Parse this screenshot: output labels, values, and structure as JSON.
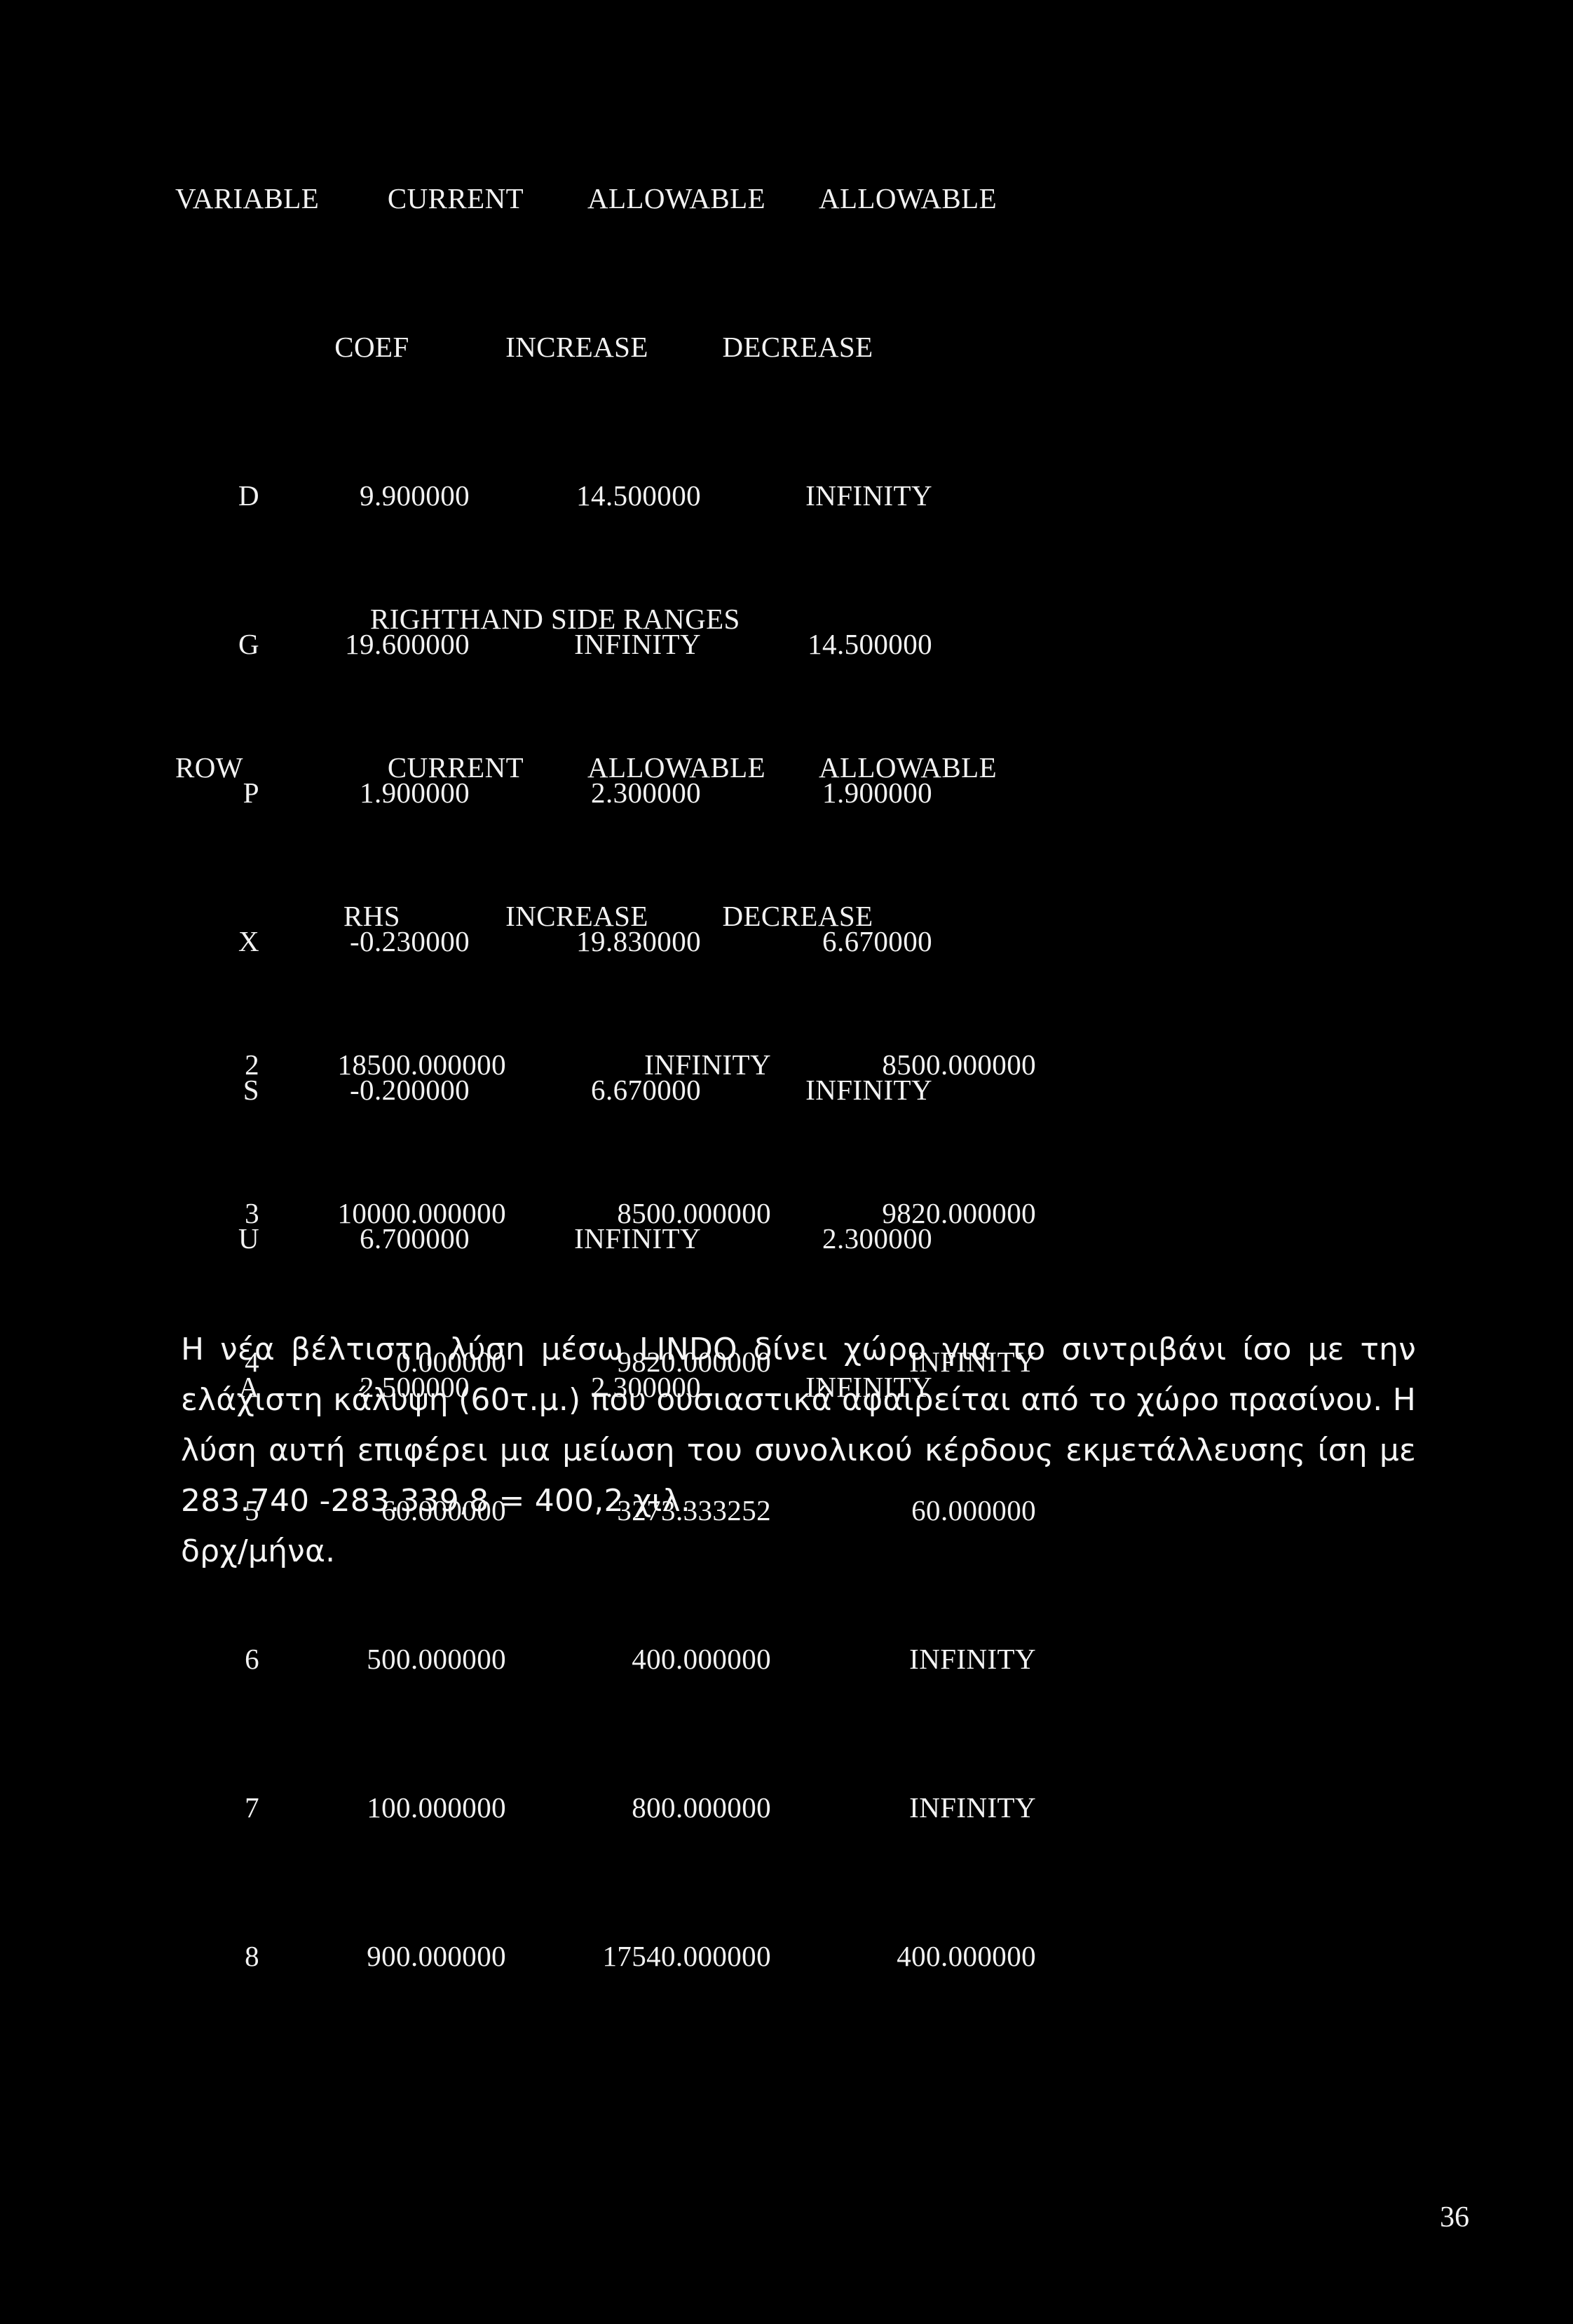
{
  "page": {
    "number": "36",
    "background_color": "#000000",
    "text_color": "#ffffff"
  },
  "objective_ranges": {
    "header_row_1": {
      "col1": "VARIABLE",
      "col2": "CURRENT",
      "col3": "ALLOWABLE",
      "col4": "ALLOWABLE"
    },
    "header_row_2": {
      "col1": "",
      "col2": "COEF",
      "col3": "INCREASE",
      "col4": "DECREASE"
    },
    "rows": [
      {
        "variable": "D",
        "current_coef": "9.900000",
        "allowable_increase": "14.500000",
        "allowable_decrease": "INFINITY"
      },
      {
        "variable": "G",
        "current_coef": "19.600000",
        "allowable_increase": "INFINITY",
        "allowable_decrease": "14.500000"
      },
      {
        "variable": "P",
        "current_coef": "1.900000",
        "allowable_increase": "2.300000",
        "allowable_decrease": "1.900000"
      },
      {
        "variable": "X",
        "current_coef": "-0.230000",
        "allowable_increase": "19.830000",
        "allowable_decrease": "6.670000"
      },
      {
        "variable": "S",
        "current_coef": "-0.200000",
        "allowable_increase": "6.670000",
        "allowable_decrease": "INFINITY"
      },
      {
        "variable": "U",
        "current_coef": "6.700000",
        "allowable_increase": "INFINITY",
        "allowable_decrease": "2.300000"
      },
      {
        "variable": "A",
        "current_coef": "2.500000",
        "allowable_increase": "2.300000",
        "allowable_decrease": "INFINITY"
      }
    ]
  },
  "rhs_ranges": {
    "section_title": "RIGHTHAND SIDE RANGES",
    "header_row_1": {
      "col1": "ROW",
      "col2": "CURRENT",
      "col3": "ALLOWABLE",
      "col4": "ALLOWABLE"
    },
    "header_row_2": {
      "col1": "",
      "col2": "RHS",
      "col3": "INCREASE",
      "col4": "DECREASE"
    },
    "rows": [
      {
        "row": "2",
        "current_rhs": "18500.000000",
        "allowable_increase": "INFINITY",
        "allowable_decrease": "8500.000000"
      },
      {
        "row": "3",
        "current_rhs": "10000.000000",
        "allowable_increase": "8500.000000",
        "allowable_decrease": "9820.000000"
      },
      {
        "row": "4",
        "current_rhs": "0.000000",
        "allowable_increase": "9820.000000",
        "allowable_decrease": "INFINITY"
      },
      {
        "row": "5",
        "current_rhs": "60.000000",
        "allowable_increase": "3273.333252",
        "allowable_decrease": "60.000000"
      },
      {
        "row": "6",
        "current_rhs": "500.000000",
        "allowable_increase": "400.000000",
        "allowable_decrease": "INFINITY"
      },
      {
        "row": "7",
        "current_rhs": "100.000000",
        "allowable_increase": "800.000000",
        "allowable_decrease": "INFINITY"
      },
      {
        "row": "8",
        "current_rhs": "900.000000",
        "allowable_increase": "17540.000000",
        "allowable_decrease": "400.000000"
      }
    ]
  },
  "commentary": {
    "body": "Η νέα βέλτιστη λύση μέσω LINDO δίνει χώρο για το σιντριβάνι ίσο με την ελάχιστη κάλυψη (60τ.μ.) που ουσιαστικά αφαιρείται από το χώρο πρασίνου. Η λύση αυτή επιφέρει μια μείωση του συνολικού κέρδους εκμετάλλευσης ίση με 283.740 -283.339,8 = 400,2 χιλ.",
    "last_line": "δρχ/μήνα."
  }
}
